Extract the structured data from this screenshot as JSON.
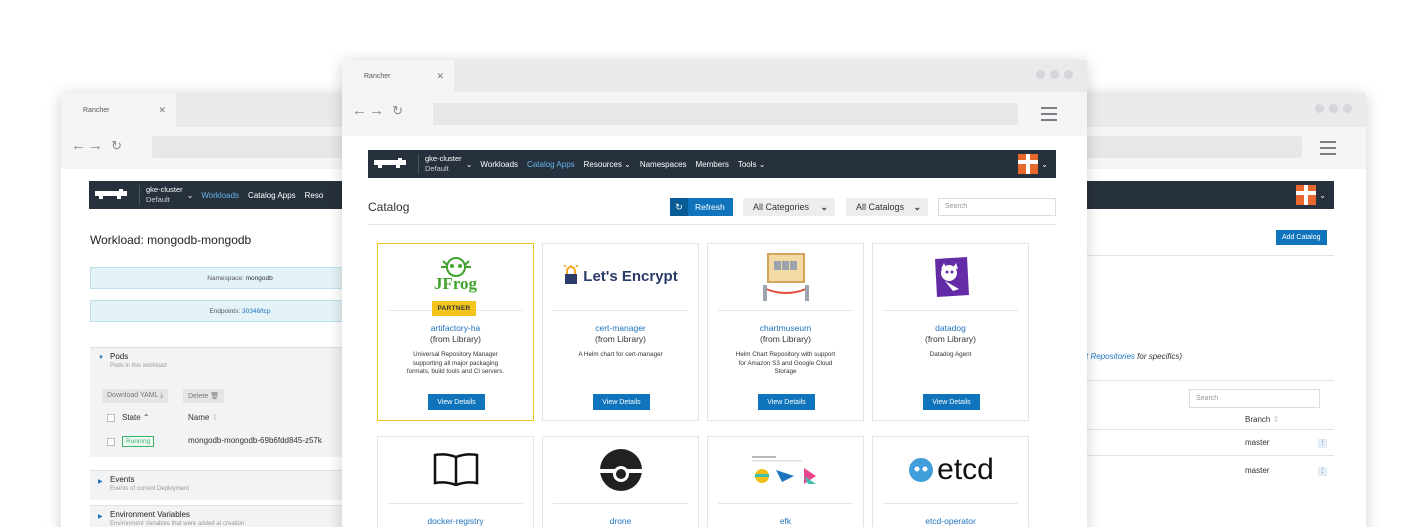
{
  "back_window": {
    "tab_title": "Rancher",
    "header": {
      "cluster_name": "gke-cluster",
      "project_name": "Default",
      "nav": [
        "Workloads",
        "Catalog Apps",
        "Reso"
      ]
    },
    "page_title": "Workload: mongodb-mongodb",
    "namespace_label": "Namespace: ",
    "namespace_value": "mongodb",
    "endpoints_label": "Endpoints: ",
    "endpoints_value": "30348/tcp",
    "pods": {
      "title": "Pods",
      "subtitle": "Pods in this workload"
    },
    "download_yaml": "Download YAML",
    "delete_label": "Delete",
    "col_state": "State",
    "col_name": "Name",
    "pod_state": "Running",
    "pod_name": "mongodb-mongodb-69b6fdd845-z57k",
    "events": {
      "title": "Events",
      "subtitle": "Events of current Deployment"
    },
    "env_vars": {
      "title": "Environment Variables",
      "subtitle": "Environment Variables that were added at creation"
    },
    "add_catalog": "Add Catalog",
    "repo_link": "t Repositories",
    "repo_suffix": " for specifics)",
    "search_placeholder": "Search",
    "col_branch": "Branch",
    "branch_rows": [
      "master",
      "master"
    ]
  },
  "front_window": {
    "tab_title": "Rancher",
    "header": {
      "cluster_name": "gke-cluster",
      "project_name": "Default",
      "nav": [
        "Workloads",
        "Catalog Apps",
        "Resources",
        "Namespaces",
        "Members",
        "Tools"
      ]
    },
    "catalog_title": "Catalog",
    "refresh_label": "Refresh",
    "category_select": "All Categories",
    "catalog_select": "All Catalogs",
    "search_placeholder": "Search",
    "view_details": "View Details",
    "partner_badge": "PARTNER",
    "from_library": "(from Library)",
    "cards": [
      {
        "name": "artifactory-ha",
        "desc": "Universal Repository Manager supporting all major packaging formats, build tools and CI servers.",
        "logo": "jfrog-logo",
        "logo_text": "JFrog"
      },
      {
        "name": "cert-manager",
        "desc": "A Helm chart for cert-manager",
        "logo": "lets-encrypt-logo",
        "logo_text": "Let's Encrypt"
      },
      {
        "name": "chartmuseum",
        "desc": "Helm Chart Repository with support for Amazon S3 and Google Cloud Storage",
        "logo": "chartmuseum-logo"
      },
      {
        "name": "datadog",
        "desc": "Datadog Agent",
        "logo": "datadog-logo"
      },
      {
        "name": "docker-registry",
        "logo": "book-icon"
      },
      {
        "name": "drone",
        "logo": "drone-logo"
      },
      {
        "name": "efk",
        "logo": "efk-logo"
      },
      {
        "name": "etcd-operator",
        "logo": "etcd-logo",
        "logo_text": "etcd"
      }
    ]
  },
  "colors": {
    "header_bg": "#27313d",
    "accent_blue": "#0f74bb",
    "link_blue": "#1e73be",
    "partner_yellow": "#f2c51d",
    "running_green": "#3cb36b",
    "user_orange": "#e8682d"
  }
}
